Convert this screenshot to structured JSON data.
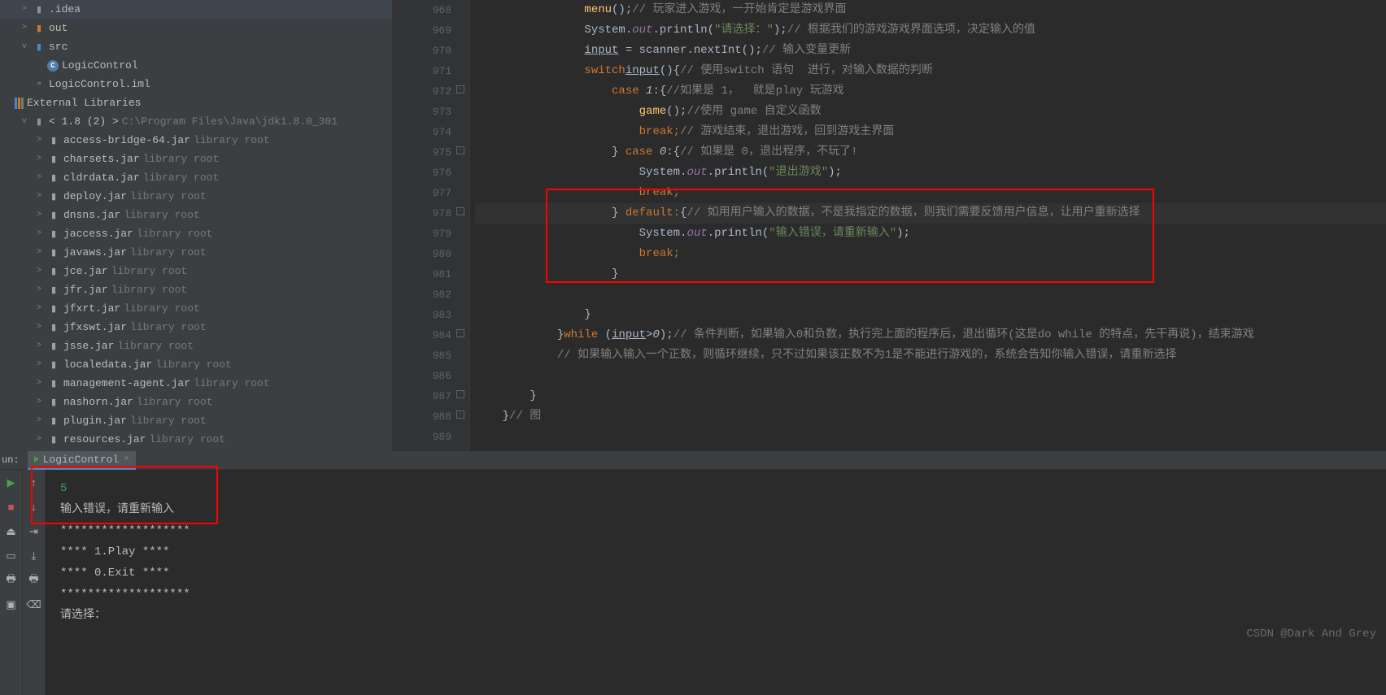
{
  "sidebar": {
    "items": [
      {
        "depth": 1,
        "chev": ">",
        "iconType": "folder",
        "iconColor": "grey",
        "label": ".idea"
      },
      {
        "depth": 1,
        "chev": ">",
        "iconType": "folder",
        "iconColor": "orange",
        "label": "out"
      },
      {
        "depth": 1,
        "chev": "v",
        "iconType": "folder",
        "iconColor": "blue",
        "label": "src"
      },
      {
        "depth": 2,
        "chev": "",
        "iconType": "class",
        "label": "LogicControl"
      },
      {
        "depth": 1,
        "chev": "",
        "iconType": "file",
        "label": "LogicControl.iml"
      },
      {
        "depth": 0,
        "chev": "",
        "iconType": "extlib",
        "label": "External Libraries"
      },
      {
        "depth": 1,
        "chev": "v",
        "iconType": "lib",
        "label": "< 1.8 (2) >",
        "suffix": "C:\\Program Files\\Java\\jdk1.8.0_301"
      }
    ],
    "jars": [
      "access-bridge-64.jar",
      "charsets.jar",
      "cldrdata.jar",
      "deploy.jar",
      "dnsns.jar",
      "jaccess.jar",
      "javaws.jar",
      "jce.jar",
      "jfr.jar",
      "jfxrt.jar",
      "jfxswt.jar",
      "jsse.jar",
      "localedata.jar",
      "management-agent.jar",
      "nashorn.jar",
      "plugin.jar",
      "resources.jar"
    ],
    "library_root": "library root"
  },
  "lines": [
    "968",
    "969",
    "970",
    "971",
    "972",
    "973",
    "974",
    "975",
    "976",
    "977",
    "978",
    "979",
    "980",
    "981",
    "982",
    "983",
    "984",
    "985",
    "986",
    "987",
    "988",
    "989"
  ],
  "code": {
    "l968": {
      "pre": "                ",
      "fn": "menu",
      "post": "();",
      "cmt": "// 玩家进入游戏，一开始肯定是游戏界面"
    },
    "l969": {
      "pre": "                System.",
      "fld": "out",
      "mid": ".println(",
      "str": "\"请选择：\"",
      "post": ");",
      "cmt": "// 根据我们的游戏游戏界面选项，决定输入的值"
    },
    "l970": {
      "pre": "                ",
      "var": "input",
      "mid": " = scanner.nextInt();",
      "cmt": "// 输入变量更新"
    },
    "l971": {
      "pre": "                ",
      "kw": "switch",
      "mid": "(",
      "var": "input",
      "post": "){",
      "cmt": "// 使用switch 语句  进行，对输入数据的判断"
    },
    "l972": {
      "pre": "                    ",
      "kw": "case ",
      "num": "1",
      "post": ":{",
      "cmt": "//如果是 1，  就是play 玩游戏"
    },
    "l973": {
      "pre": "                        ",
      "fn": "game",
      "post": "();",
      "cmt": "//使用 game 自定义函数"
    },
    "l974": {
      "pre": "                        ",
      "kw": "break;",
      "cmt": "// 游戏结束，退出游戏，回到游戏主界面"
    },
    "l975": {
      "pre": "                    } ",
      "kw": "case ",
      "num": "0",
      "post": ":{",
      "cmt": "// 如果是 0，退出程序，不玩了!"
    },
    "l976": {
      "pre": "                        System.",
      "fld": "out",
      "mid": ".println(",
      "str": "\"退出游戏\"",
      "post": ");"
    },
    "l977": {
      "pre": "                        ",
      "kw": "break;"
    },
    "l978": {
      "pre": "                    } ",
      "kw": "default:",
      "post": "{",
      "cmt": "// 如用用户输入的数据，不是我指定的数据，则我们需要反馈用户信息，让用户重新选择"
    },
    "l979": {
      "pre": "                        System.",
      "fld": "out",
      "mid": ".println(",
      "str": "\"输入错误，请重新输入\"",
      "post": ");"
    },
    "l980": {
      "pre": "                        ",
      "kw": "break;"
    },
    "l981": {
      "pre": "                    }"
    },
    "l982": {
      "pre": ""
    },
    "l983": {
      "pre": "                }"
    },
    "l984": {
      "pre": "            }",
      "kw": "while ",
      "mid": "(",
      "var": "input",
      "post": ">",
      "num": "0",
      "end": ");",
      "cmt": "// 条件判断，如果输入0和负数，执行完上面的程序后，退出循环(这是do while 的特点，先干再说)，结束游戏"
    },
    "l985": {
      "pre": "            ",
      "cmt": "// 如果输入输入一个正数，则循环继续，只不过如果该正数不为1是不能进行游戏的，系统会告知你输入错误，请重新选择"
    },
    "l986": {
      "pre": ""
    },
    "l987": {
      "pre": "        }"
    },
    "l988": {
      "pre": "    }",
      "cmt": "// 图"
    },
    "l989": {
      "pre": ""
    }
  },
  "run": {
    "label": "un:",
    "tab": "LogicControl",
    "console": [
      {
        "text": "5",
        "cls": "input"
      },
      {
        "text": "输入错误，请重新输入"
      },
      {
        "text": "*******************"
      },
      {
        "text": "****  1.Play  ****"
      },
      {
        "text": "****  0.Exit  ****"
      },
      {
        "text": "*******************"
      },
      {
        "text": "请选择："
      }
    ]
  },
  "watermark": "CSDN @Dark And Grey"
}
